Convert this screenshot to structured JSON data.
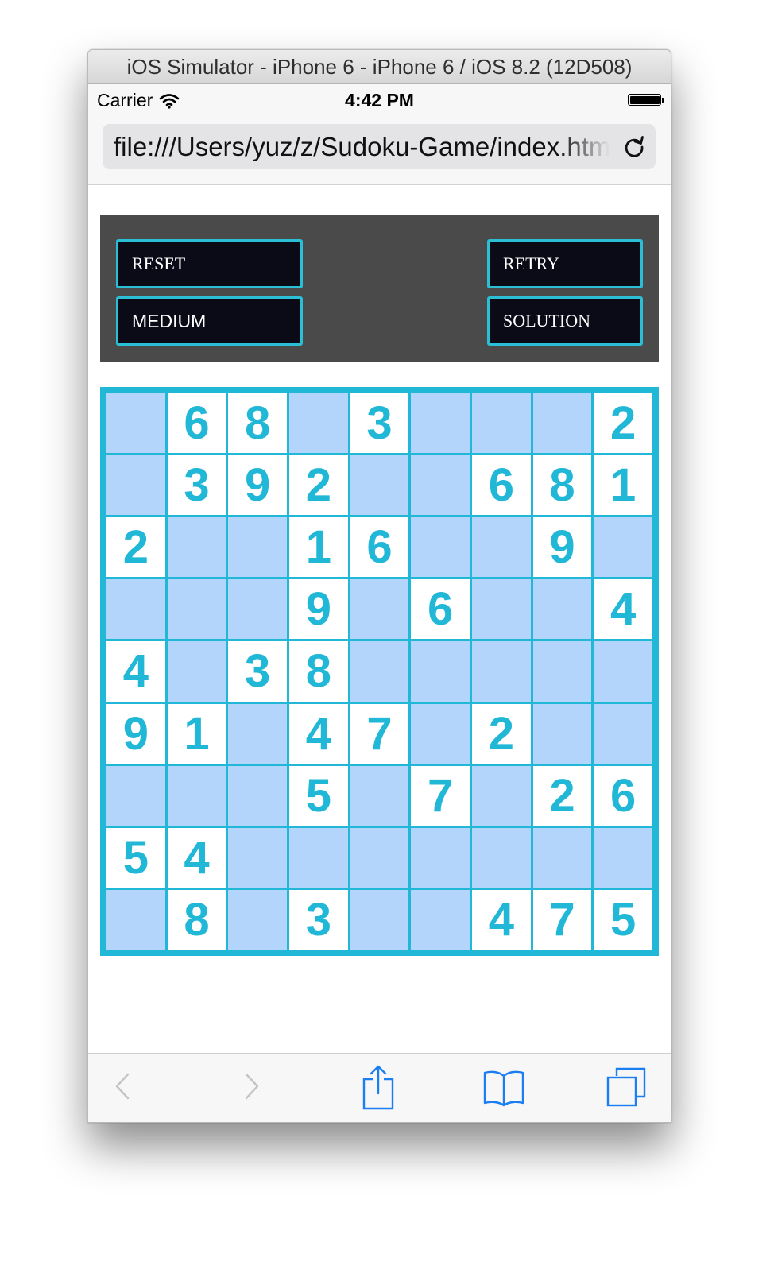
{
  "window": {
    "title": "iOS Simulator - iPhone 6 - iPhone 6 / iOS 8.2 (12D508)"
  },
  "status_bar": {
    "carrier": "Carrier",
    "time": "4:42 PM"
  },
  "address_bar": {
    "url": "file:///Users/yuz/z/Sudoku-Game/index.html"
  },
  "controls": {
    "reset_label": "RESET",
    "retry_label": "RETRY",
    "difficulty_label": "MEDIUM",
    "solution_label": "SOLUTION"
  },
  "board": {
    "rows": [
      [
        "",
        "6",
        "8",
        "",
        "3",
        "",
        "",
        "",
        "2"
      ],
      [
        "",
        "3",
        "9",
        "2",
        "",
        "",
        "6",
        "8",
        "1"
      ],
      [
        "2",
        "",
        "",
        "1",
        "6",
        "",
        "",
        "9",
        ""
      ],
      [
        "",
        "",
        "",
        "9",
        "",
        "6",
        "",
        "",
        "4"
      ],
      [
        "4",
        "",
        "3",
        "8",
        "",
        "",
        "",
        "",
        ""
      ],
      [
        "9",
        "1",
        "",
        "4",
        "7",
        "",
        "2",
        "",
        ""
      ],
      [
        "",
        "",
        "",
        "5",
        "",
        "7",
        "",
        "2",
        "6"
      ],
      [
        "5",
        "4",
        "",
        "",
        "",
        "",
        "",
        "",
        ""
      ],
      [
        "",
        "8",
        "",
        "3",
        "",
        "",
        "4",
        "7",
        "5"
      ]
    ]
  },
  "colors": {
    "accent": "#21b7d6",
    "empty_cell": "#b3d4fb",
    "given_cell": "#ffffff",
    "control_panel": "#4a4a4a",
    "button_bg": "#0b0b18",
    "ios_tint": "#1b7ef2"
  },
  "toolbar": {
    "icons": [
      "back-icon",
      "forward-icon",
      "share-icon",
      "bookmarks-icon",
      "tabs-icon"
    ]
  }
}
